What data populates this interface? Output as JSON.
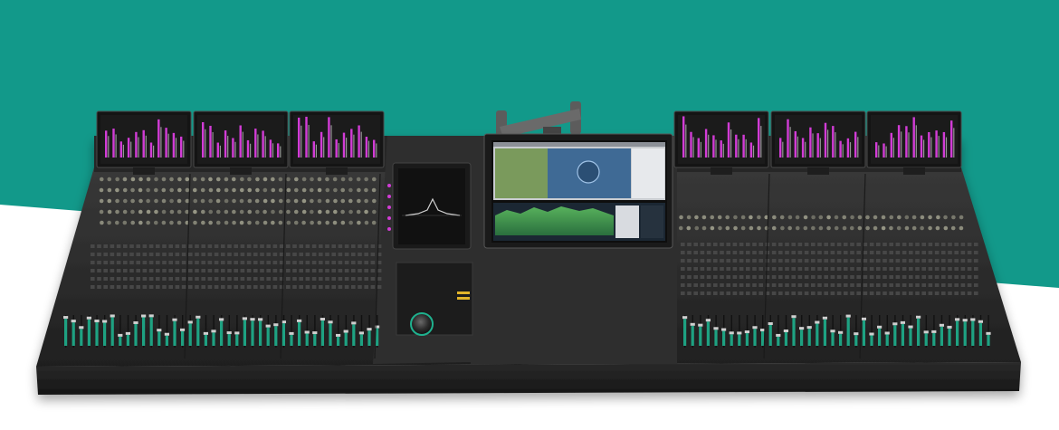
{
  "image": {
    "subject": "large-format-mixing-console",
    "colors": {
      "teal_band": "#12998a",
      "white_bg": "#ffffff",
      "console_body": "#2b2b2b",
      "console_dark": "#1d1d1d",
      "meter_magenta": "#d23cd6",
      "fader_teal": "#1fb18e",
      "knob_light": "#9c9c8a",
      "screen_blue": "#4a78a8",
      "screen_green": "#2f8a4c"
    },
    "left_meter_screens": 3,
    "right_meter_screens": 3,
    "center_display_count": 1,
    "center_control_panel": 1
  }
}
